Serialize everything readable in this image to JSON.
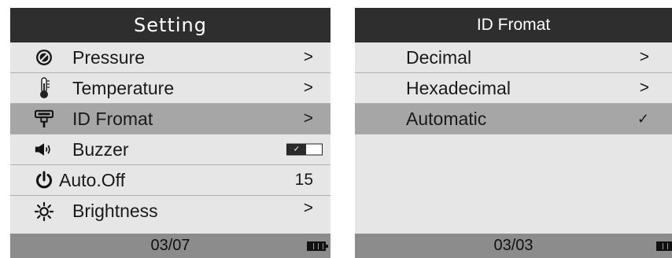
{
  "left_panel": {
    "title": "Setting",
    "items": [
      {
        "icon": "pressure-icon",
        "label": "Pressure",
        "value": ">"
      },
      {
        "icon": "thermometer-icon",
        "label": "Temperature",
        "value": ">"
      },
      {
        "icon": "tpms-sensor-icon",
        "label": "ID Fromat",
        "value": ">"
      },
      {
        "icon": "speaker-icon",
        "label": "Buzzer",
        "value": ""
      },
      {
        "icon": "power-icon",
        "label": "Auto.Off",
        "value": "15"
      },
      {
        "icon": "sun-icon",
        "label": "Brightness",
        "value": ">"
      }
    ],
    "selected_index": 2,
    "buzzer_enabled": true,
    "buzzer_check": "✓",
    "page": "03/07",
    "battery": "full"
  },
  "right_panel": {
    "title": "ID Fromat",
    "items": [
      {
        "label": "Decimal",
        "value": ">"
      },
      {
        "label": "Hexadecimal",
        "value": ">"
      },
      {
        "label": "Automatic",
        "value": "✓"
      }
    ],
    "selected_index": 2,
    "page": "03/03",
    "battery": "full"
  }
}
